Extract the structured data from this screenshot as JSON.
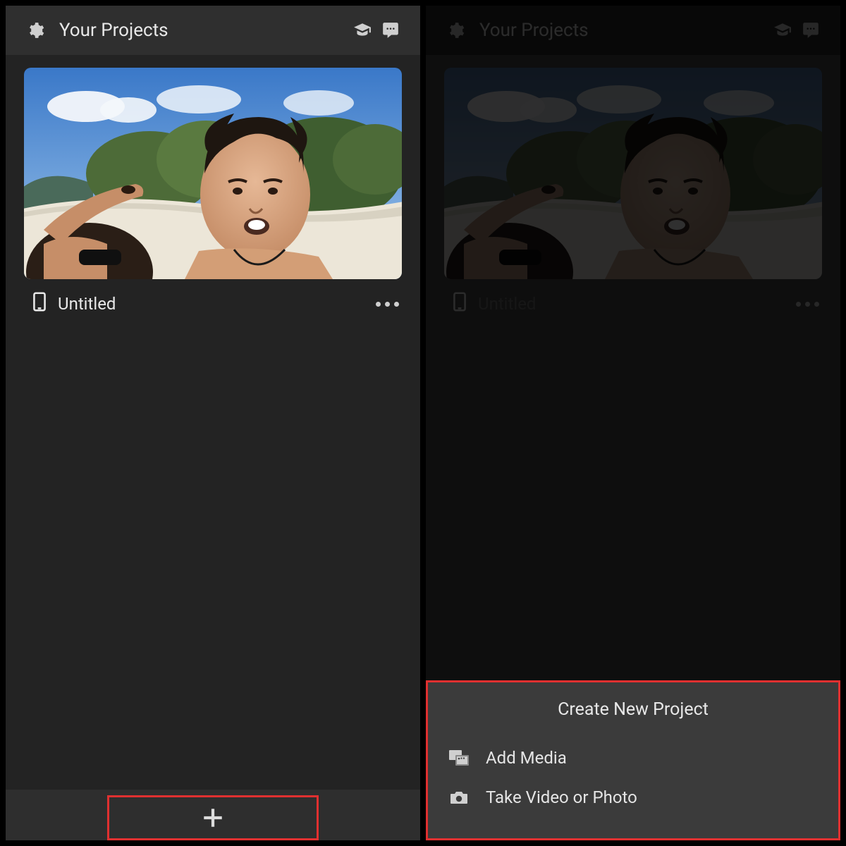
{
  "left": {
    "header": {
      "title": "Your Projects"
    },
    "project": {
      "name": "Untitled"
    },
    "icons": {
      "settings": "gear-icon",
      "learn": "graduation-cap-icon",
      "chat": "speech-bubble-icon",
      "device": "phone-icon",
      "more": "more-options-icon",
      "add": "plus-icon"
    }
  },
  "right": {
    "header": {
      "title": "Your Projects"
    },
    "project": {
      "name": "Untitled"
    },
    "sheet": {
      "title": "Create New Project",
      "items": [
        {
          "label": "Add Media",
          "icon": "media-icon"
        },
        {
          "label": "Take Video or Photo",
          "icon": "camera-icon"
        }
      ]
    }
  }
}
